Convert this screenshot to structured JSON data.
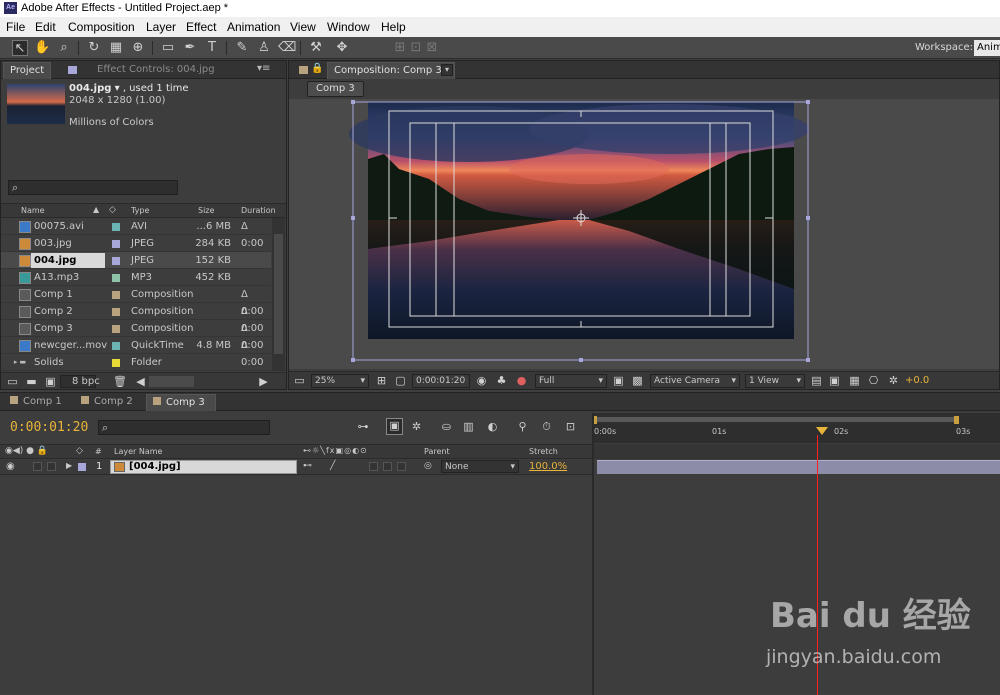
{
  "window": {
    "title": "Adobe After Effects - Untitled Project.aep *",
    "logo": "Ae"
  },
  "menu": [
    "File",
    "Edit",
    "Composition",
    "Layer",
    "Effect",
    "Animation",
    "View",
    "Window",
    "Help"
  ],
  "toolbar": {
    "workspace_label": "Workspace:",
    "workspace_value": "Anim"
  },
  "project_panel": {
    "tab_project": "Project",
    "tab_effects": "Effect Controls: 004.jpg",
    "preview_name": "004.jpg",
    "preview_used": ", used 1 time",
    "preview_dims": "2048 x 1280 (1.00)",
    "preview_colors": "Millions of Colors",
    "columns": {
      "name": "Name",
      "type": "Type",
      "size": "Size",
      "duration": "Duration"
    },
    "items": [
      {
        "name": "00075.avi",
        "type": "AVI",
        "size": "...6 MB",
        "duration": "Δ 0:00",
        "label_color": "#6cb4b4",
        "icon": "video-file-icon"
      },
      {
        "name": "003.jpg",
        "type": "JPEG",
        "size": "284 KB",
        "duration": "",
        "label_color": "#a7a7d9",
        "icon": "image-file-icon"
      },
      {
        "name": "004.jpg",
        "type": "JPEG",
        "size": "152 KB",
        "duration": "",
        "label_color": "#a7a7d9",
        "icon": "image-file-icon"
      },
      {
        "name": "A13.mp3",
        "type": "MP3",
        "size": "452 KB",
        "duration": "",
        "label_color": "#8fc3a8",
        "icon": "audio-file-icon"
      },
      {
        "name": "Comp 1",
        "type": "Composition",
        "size": "",
        "duration": "Δ 0:00",
        "label_color": "#b9a37e",
        "icon": "composition-icon"
      },
      {
        "name": "Comp 2",
        "type": "Composition",
        "size": "",
        "duration": "Δ 0:00",
        "label_color": "#b9a37e",
        "icon": "composition-icon"
      },
      {
        "name": "Comp 3",
        "type": "Composition",
        "size": "",
        "duration": "Δ 0:00",
        "label_color": "#b9a37e",
        "icon": "composition-icon"
      },
      {
        "name": "newcger...mov",
        "type": "QuickTime",
        "size": "4.8 MB",
        "duration": "Δ 0:00",
        "label_color": "#6cb4b4",
        "icon": "video-file-icon"
      },
      {
        "name": "Solids",
        "type": "Folder",
        "size": "",
        "duration": "",
        "label_color": "#e8d838",
        "icon": "folder-icon"
      }
    ],
    "bpc": "8 bpc"
  },
  "comp_panel": {
    "tab_label": "Composition: Comp 3",
    "breadcrumb": "Comp 3",
    "zoom": "25%",
    "timecode": "0:00:01:20",
    "resolution": "Full",
    "camera": "Active Camera",
    "view": "1 View",
    "exposure": "+0.0"
  },
  "timeline": {
    "tabs": [
      "Comp 1",
      "Comp 2",
      "Comp 3"
    ],
    "current_time": "0:00:01:20",
    "ruler_labels": [
      "0:00s",
      "01s",
      "02s",
      "03s"
    ],
    "col_layer_name": "Layer Name",
    "col_parent": "Parent",
    "col_stretch": "Stretch",
    "layer": {
      "index": "1",
      "name": "[004.jpg]",
      "parent": "None",
      "stretch": "100.0%"
    },
    "playhead_fraction": 0.55
  },
  "watermark": {
    "text": "jingyan.baidu.com",
    "logo_text": "Bai du 经验"
  },
  "colors": {
    "accent_orange": "#e8b43a",
    "timeline_bar": "#8c8ca8",
    "playhead": "#ff2020"
  }
}
